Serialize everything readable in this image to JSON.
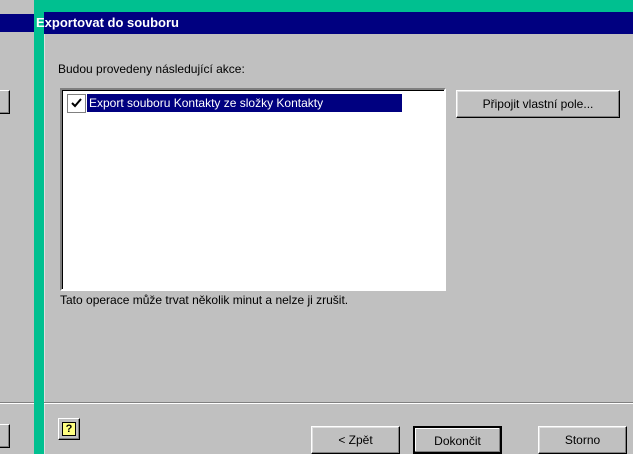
{
  "dialog": {
    "title": "Exportovat do souboru",
    "intro": "Budou provedeny následující akce:",
    "actions": [
      {
        "label": "Export souboru Kontakty ze složky Kontakty",
        "checked": true
      }
    ],
    "map_fields_label": "Připojit vlastní pole...",
    "note": "Tato operace může trvat několik minut a nelze ji zrušit.",
    "help_icon": "question-icon",
    "help_glyph": "?",
    "back_label": "< Zpět",
    "finish_label": "Dokončit",
    "cancel_label": "Storno"
  },
  "colors": {
    "desktop": "#00c090",
    "titlebar": "#000080",
    "face": "#c0c0c0",
    "selection": "#000080"
  }
}
